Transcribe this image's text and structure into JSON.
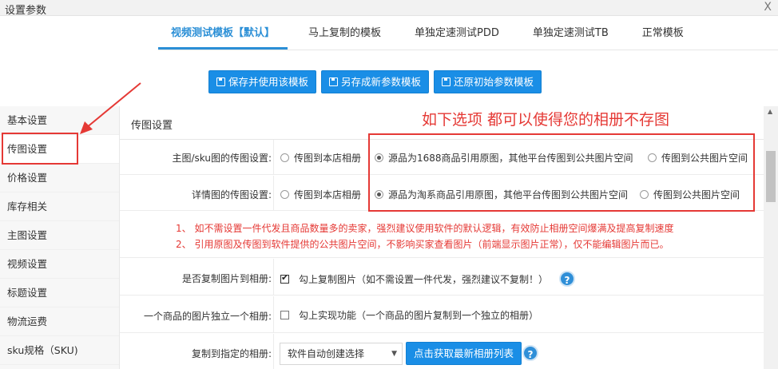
{
  "window": {
    "title": "设置参数",
    "close": "X"
  },
  "tabs": [
    {
      "label": "视频测试模板【默认】"
    },
    {
      "label": "马上复制的模板"
    },
    {
      "label": "单独定速测试PDD"
    },
    {
      "label": "单独定速测试TB"
    },
    {
      "label": "正常模板"
    }
  ],
  "buttons": {
    "save_use": "保存并使用该模板",
    "save_new": "另存成新参数模板",
    "restore": "还原初始参数模板"
  },
  "sidebar": [
    {
      "label": "基本设置"
    },
    {
      "label": "传图设置"
    },
    {
      "label": "价格设置"
    },
    {
      "label": "库存相关"
    },
    {
      "label": "主图设置"
    },
    {
      "label": "视频设置"
    },
    {
      "label": "标题设置"
    },
    {
      "label": "物流运费"
    },
    {
      "label": "sku规格（SKU)"
    }
  ],
  "section_title": "传图设置",
  "annotation": "如下选项  都可以使得您的相册不存图",
  "rows": {
    "main_img": {
      "label": "主图/sku图的传图设置:",
      "opt1": "传图到本店相册",
      "opt2": "源品为1688商品引用原图，其他平台传图到公共图片空间",
      "opt3": "传图到公共图片空间",
      "selected": 2
    },
    "detail_img": {
      "label": "详情图的传图设置:",
      "opt1": "传图到本店相册",
      "opt2": "源品为淘系商品引用原图，其他平台传图到公共图片空间",
      "opt3": "传图到公共图片空间",
      "selected": 2
    },
    "warnings": {
      "w1": "1、 如不需设置一件代发且商品数量多的卖家，强烈建议使用软件的默认逻辑，有效防止相册空间爆满及提高复制速度",
      "w2": "2、 引用原图及传图到软件提供的公共图片空间，不影响买家查看图片（前端显示图片正常），仅不能编辑图片而已。"
    },
    "copy_to_album": {
      "label": "是否复制图片到相册:",
      "text": "勾上复制图片（如不需设置一件代发，强烈建议不复制！）",
      "checked": true,
      "help": "?"
    },
    "one_album": {
      "label": "一个商品的图片独立一个相册:",
      "text": "勾上实现功能（一个商品的图片复制到一个独立的相册）",
      "checked": false
    },
    "target_album": {
      "label": "复制到指定的相册:",
      "select_value": "软件自动创建选择",
      "button": "点击获取最新相册列表",
      "help": "?"
    }
  },
  "colors": {
    "accent": "#1a8ee6",
    "annotation": "#e53935"
  }
}
